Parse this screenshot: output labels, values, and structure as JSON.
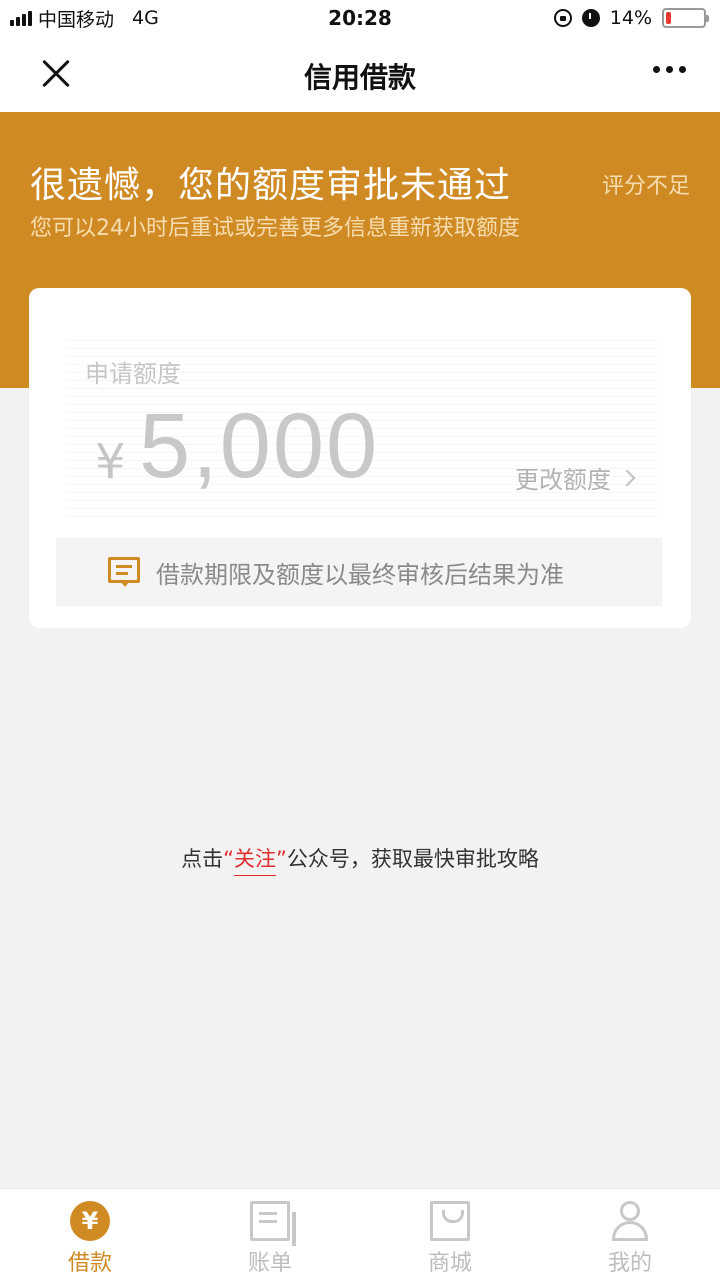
{
  "status_bar": {
    "carrier": "中国移动",
    "network": "4G",
    "time": "20:28",
    "battery_percent_label": "14%",
    "battery_level": 0.14
  },
  "nav": {
    "title": "信用借款",
    "close_icon": "close-icon",
    "more_icon": "more-icon"
  },
  "banner": {
    "title": "很遗憾，您的额度审批未通过",
    "reason": "评分不足",
    "subtitle": "您可以24小时后重试或完善更多信息重新获取额度",
    "color": "#d08a23"
  },
  "card": {
    "amount_label": "申请额度",
    "currency": "¥",
    "amount": "5,000",
    "change_label": "更改额度",
    "notice_text": "借款期限及额度以最终审核后结果为准"
  },
  "follow": {
    "prefix": "点击",
    "open_quote": "“",
    "link_text": "关注",
    "close_quote": "”",
    "suffix": "公众号，获取最快审批攻略"
  },
  "tabs": [
    {
      "label": "借款",
      "icon": "yen-icon",
      "active": true
    },
    {
      "label": "账单",
      "icon": "bill-icon",
      "active": false
    },
    {
      "label": "商城",
      "icon": "shop-icon",
      "active": false
    },
    {
      "label": "我的",
      "icon": "user-icon",
      "active": false
    }
  ],
  "colors": {
    "accent": "#d08a23",
    "link_red": "#e02e2e",
    "battery_low": "#e8382f"
  }
}
